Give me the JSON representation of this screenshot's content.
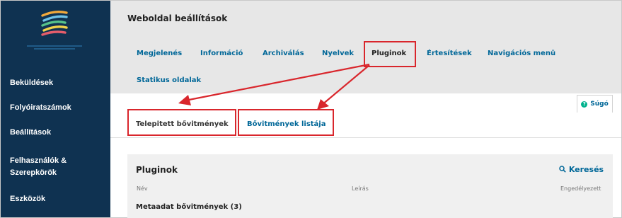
{
  "header": {
    "title": "Weboldal beállítások"
  },
  "tabs": [
    {
      "label": "Megjelenés"
    },
    {
      "label": "Információ"
    },
    {
      "label": "Archiválás"
    },
    {
      "label": "Nyelvek"
    },
    {
      "label": "Pluginok"
    },
    {
      "label": "Értesítések"
    },
    {
      "label": "Navigációs menü"
    },
    {
      "label": "Statikus oldalak"
    }
  ],
  "help": {
    "label": "Súgó",
    "icon": "help-circle-icon"
  },
  "sidebar": {
    "items": [
      {
        "label": "Beküldések"
      },
      {
        "label": "Folyóiratszámok"
      },
      {
        "label": "Beállítások"
      },
      {
        "label": "Felhasználók &"
      },
      {
        "label": "Szerepkörök"
      },
      {
        "label": "Eszközök"
      }
    ]
  },
  "subtabs": [
    {
      "label": "Telepitett bővitmények"
    },
    {
      "label": "Bővitmények listája"
    }
  ],
  "plugins": {
    "title": "Pluginok",
    "search_label": "Keresés",
    "search_icon": "search-icon",
    "columns": [
      "Név",
      "Leírás",
      "Engedélyezett"
    ],
    "group": "Metaadat bővitmények (3)"
  },
  "colors": {
    "sidebar": "#0f3251",
    "link": "#006798",
    "highlight": "#d9262c",
    "help_badge": "#00b28d"
  }
}
